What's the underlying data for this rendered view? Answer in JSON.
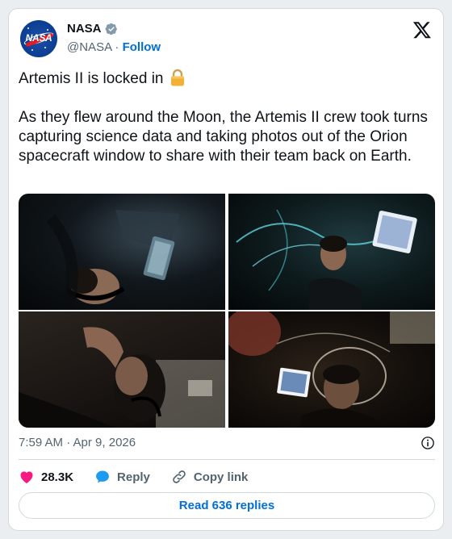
{
  "account": {
    "display_name": "NASA",
    "handle": "@NASA",
    "separator": " · ",
    "follow_label": "Follow",
    "avatar_logo_text": "NASA"
  },
  "tweet": {
    "line1": "Artemis II is locked in",
    "body": "As they flew around the Moon, the Artemis II crew took turns capturing science data and taking photos out of the Orion spacecraft window to share with their team back on Earth.",
    "timestamp": "7:59 AM · Apr 9, 2026"
  },
  "actions": {
    "likes": "28.3K",
    "reply_label": "Reply",
    "copy_link_label": "Copy link"
  },
  "read_replies_label": "Read 636 replies",
  "icons": [
    "nasa-avatar",
    "verified-badge-icon",
    "x-logo-icon",
    "lock-icon",
    "info-icon",
    "heart-icon",
    "reply-icon",
    "link-icon"
  ],
  "colors": {
    "accent": "#006fd6",
    "heart": "#f91880",
    "reply_bubble": "#1d9bf0",
    "text_primary": "#0f1419",
    "text_secondary": "#536471",
    "border": "#cfd9de"
  }
}
